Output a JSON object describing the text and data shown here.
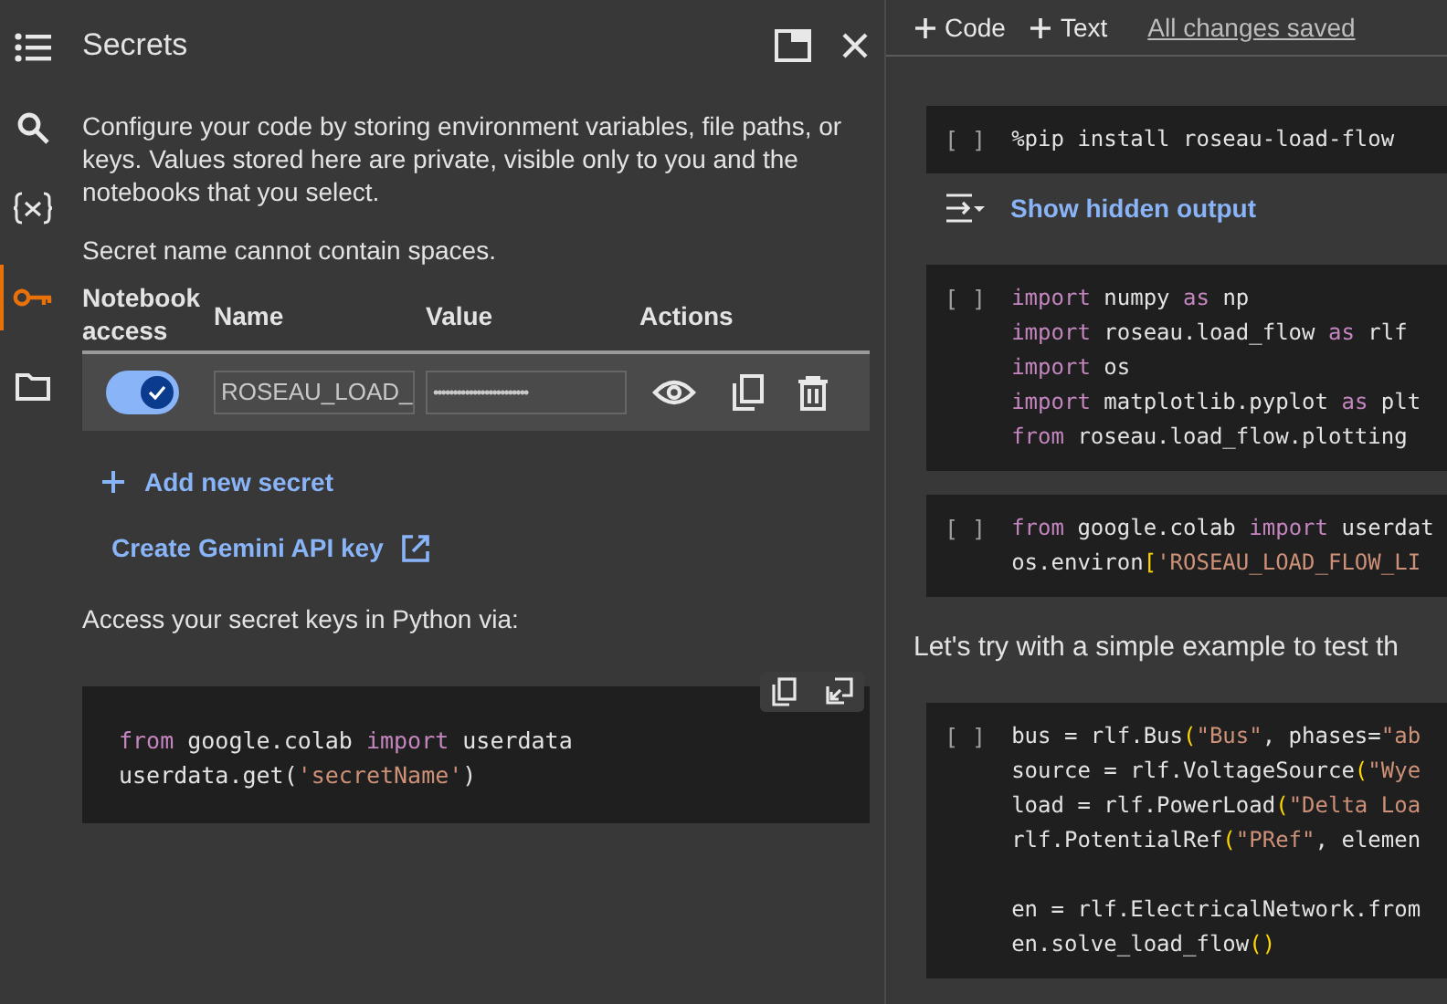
{
  "sidebar": {
    "items": [
      {
        "kind": "toc",
        "selected": false
      },
      {
        "kind": "search",
        "selected": false
      },
      {
        "kind": "variables",
        "selected": false
      },
      {
        "kind": "key",
        "selected": true
      },
      {
        "kind": "folder",
        "selected": false
      }
    ]
  },
  "panel": {
    "title": "Secrets",
    "description": "Configure your code by storing environment variables, file paths, or keys. Values stored here are private, visible only to you and the notebooks that you select.",
    "note": "Secret name cannot contain spaces.",
    "columns": [
      "Notebook access",
      "Name",
      "Value",
      "Actions"
    ],
    "secrets": [
      {
        "access": true,
        "name": "ROSEAU_LOAD_",
        "value": "••••••••••••••••••••••••"
      }
    ],
    "add_label": "Add new secret",
    "gemini_label": "Create Gemini API key",
    "access_text": "Access your secret keys in Python via:",
    "snippet": [
      [
        {
          "t": "from",
          "kind": "kw"
        },
        {
          "t": " google.colab ",
          "kind": "id"
        },
        {
          "t": "import",
          "kind": "kw"
        },
        {
          "t": " userdata",
          "kind": "id"
        }
      ],
      [
        {
          "t": "userdata.get",
          "kind": "id"
        },
        {
          "t": "(",
          "kind": "id"
        },
        {
          "t": "'secretName'",
          "kind": "str"
        },
        {
          "t": ")",
          "kind": "id"
        }
      ]
    ]
  },
  "toolbar": {
    "add_code": "Code",
    "add_text": "Text",
    "status": "All changes saved"
  },
  "cells": [
    {
      "kind": "code",
      "prompt": "[ ]",
      "lines": [
        [
          {
            "t": "%pip install roseau-load-flow",
            "kind": "id"
          }
        ]
      ]
    },
    {
      "kind": "output",
      "label": "Show hidden output"
    },
    {
      "kind": "code",
      "prompt": "[ ]",
      "lines": [
        [
          {
            "t": "import",
            "kind": "kw"
          },
          {
            "t": " numpy ",
            "kind": "id"
          },
          {
            "t": "as",
            "kind": "kw"
          },
          {
            "t": " np",
            "kind": "id"
          }
        ],
        [
          {
            "t": "import",
            "kind": "kw"
          },
          {
            "t": " roseau.load_flow ",
            "kind": "id"
          },
          {
            "t": "as",
            "kind": "kw"
          },
          {
            "t": " rlf",
            "kind": "id"
          }
        ],
        [
          {
            "t": "import",
            "kind": "kw"
          },
          {
            "t": " os",
            "kind": "id"
          }
        ],
        [
          {
            "t": "import",
            "kind": "kw"
          },
          {
            "t": " matplotlib.pyplot ",
            "kind": "id"
          },
          {
            "t": "as",
            "kind": "kw"
          },
          {
            "t": " plt",
            "kind": "id"
          }
        ],
        [
          {
            "t": "from",
            "kind": "kw"
          },
          {
            "t": " roseau.load_flow.plotting",
            "kind": "id"
          }
        ]
      ]
    },
    {
      "kind": "code",
      "prompt": "[ ]",
      "lines": [
        [
          {
            "t": "from",
            "kind": "kw"
          },
          {
            "t": " google.colab ",
            "kind": "id"
          },
          {
            "t": "import",
            "kind": "kw"
          },
          {
            "t": " userdat",
            "kind": "id"
          }
        ],
        [
          {
            "t": "os.environ",
            "kind": "id"
          },
          {
            "t": "[",
            "kind": "br"
          },
          {
            "t": "'ROSEAU_LOAD_FLOW_LI",
            "kind": "str"
          }
        ]
      ]
    },
    {
      "kind": "text",
      "text": "Let's try with a simple example to test th"
    },
    {
      "kind": "code",
      "prompt": "[ ]",
      "lines": [
        [
          {
            "t": "bus = rlf.Bus",
            "kind": "id"
          },
          {
            "t": "(",
            "kind": "br"
          },
          {
            "t": "\"Bus\"",
            "kind": "str"
          },
          {
            "t": ", phases=",
            "kind": "id"
          },
          {
            "t": "\"ab",
            "kind": "str"
          }
        ],
        [
          {
            "t": "source = rlf.VoltageSource",
            "kind": "id"
          },
          {
            "t": "(",
            "kind": "br"
          },
          {
            "t": "\"Wye",
            "kind": "str"
          }
        ],
        [
          {
            "t": "load = rlf.PowerLoad",
            "kind": "id"
          },
          {
            "t": "(",
            "kind": "br"
          },
          {
            "t": "\"Delta Loa",
            "kind": "str"
          }
        ],
        [
          {
            "t": "rlf.PotentialRef",
            "kind": "id"
          },
          {
            "t": "(",
            "kind": "br"
          },
          {
            "t": "\"PRef\"",
            "kind": "str"
          },
          {
            "t": ", elemen",
            "kind": "id"
          }
        ]
      ],
      "lines_after_gap": [
        [
          {
            "t": "en = rlf.ElectricalNetwork.from",
            "kind": "id"
          }
        ],
        [
          {
            "t": "en.solve_load_flow",
            "kind": "id"
          },
          {
            "t": "()",
            "kind": "br"
          }
        ]
      ]
    }
  ]
}
